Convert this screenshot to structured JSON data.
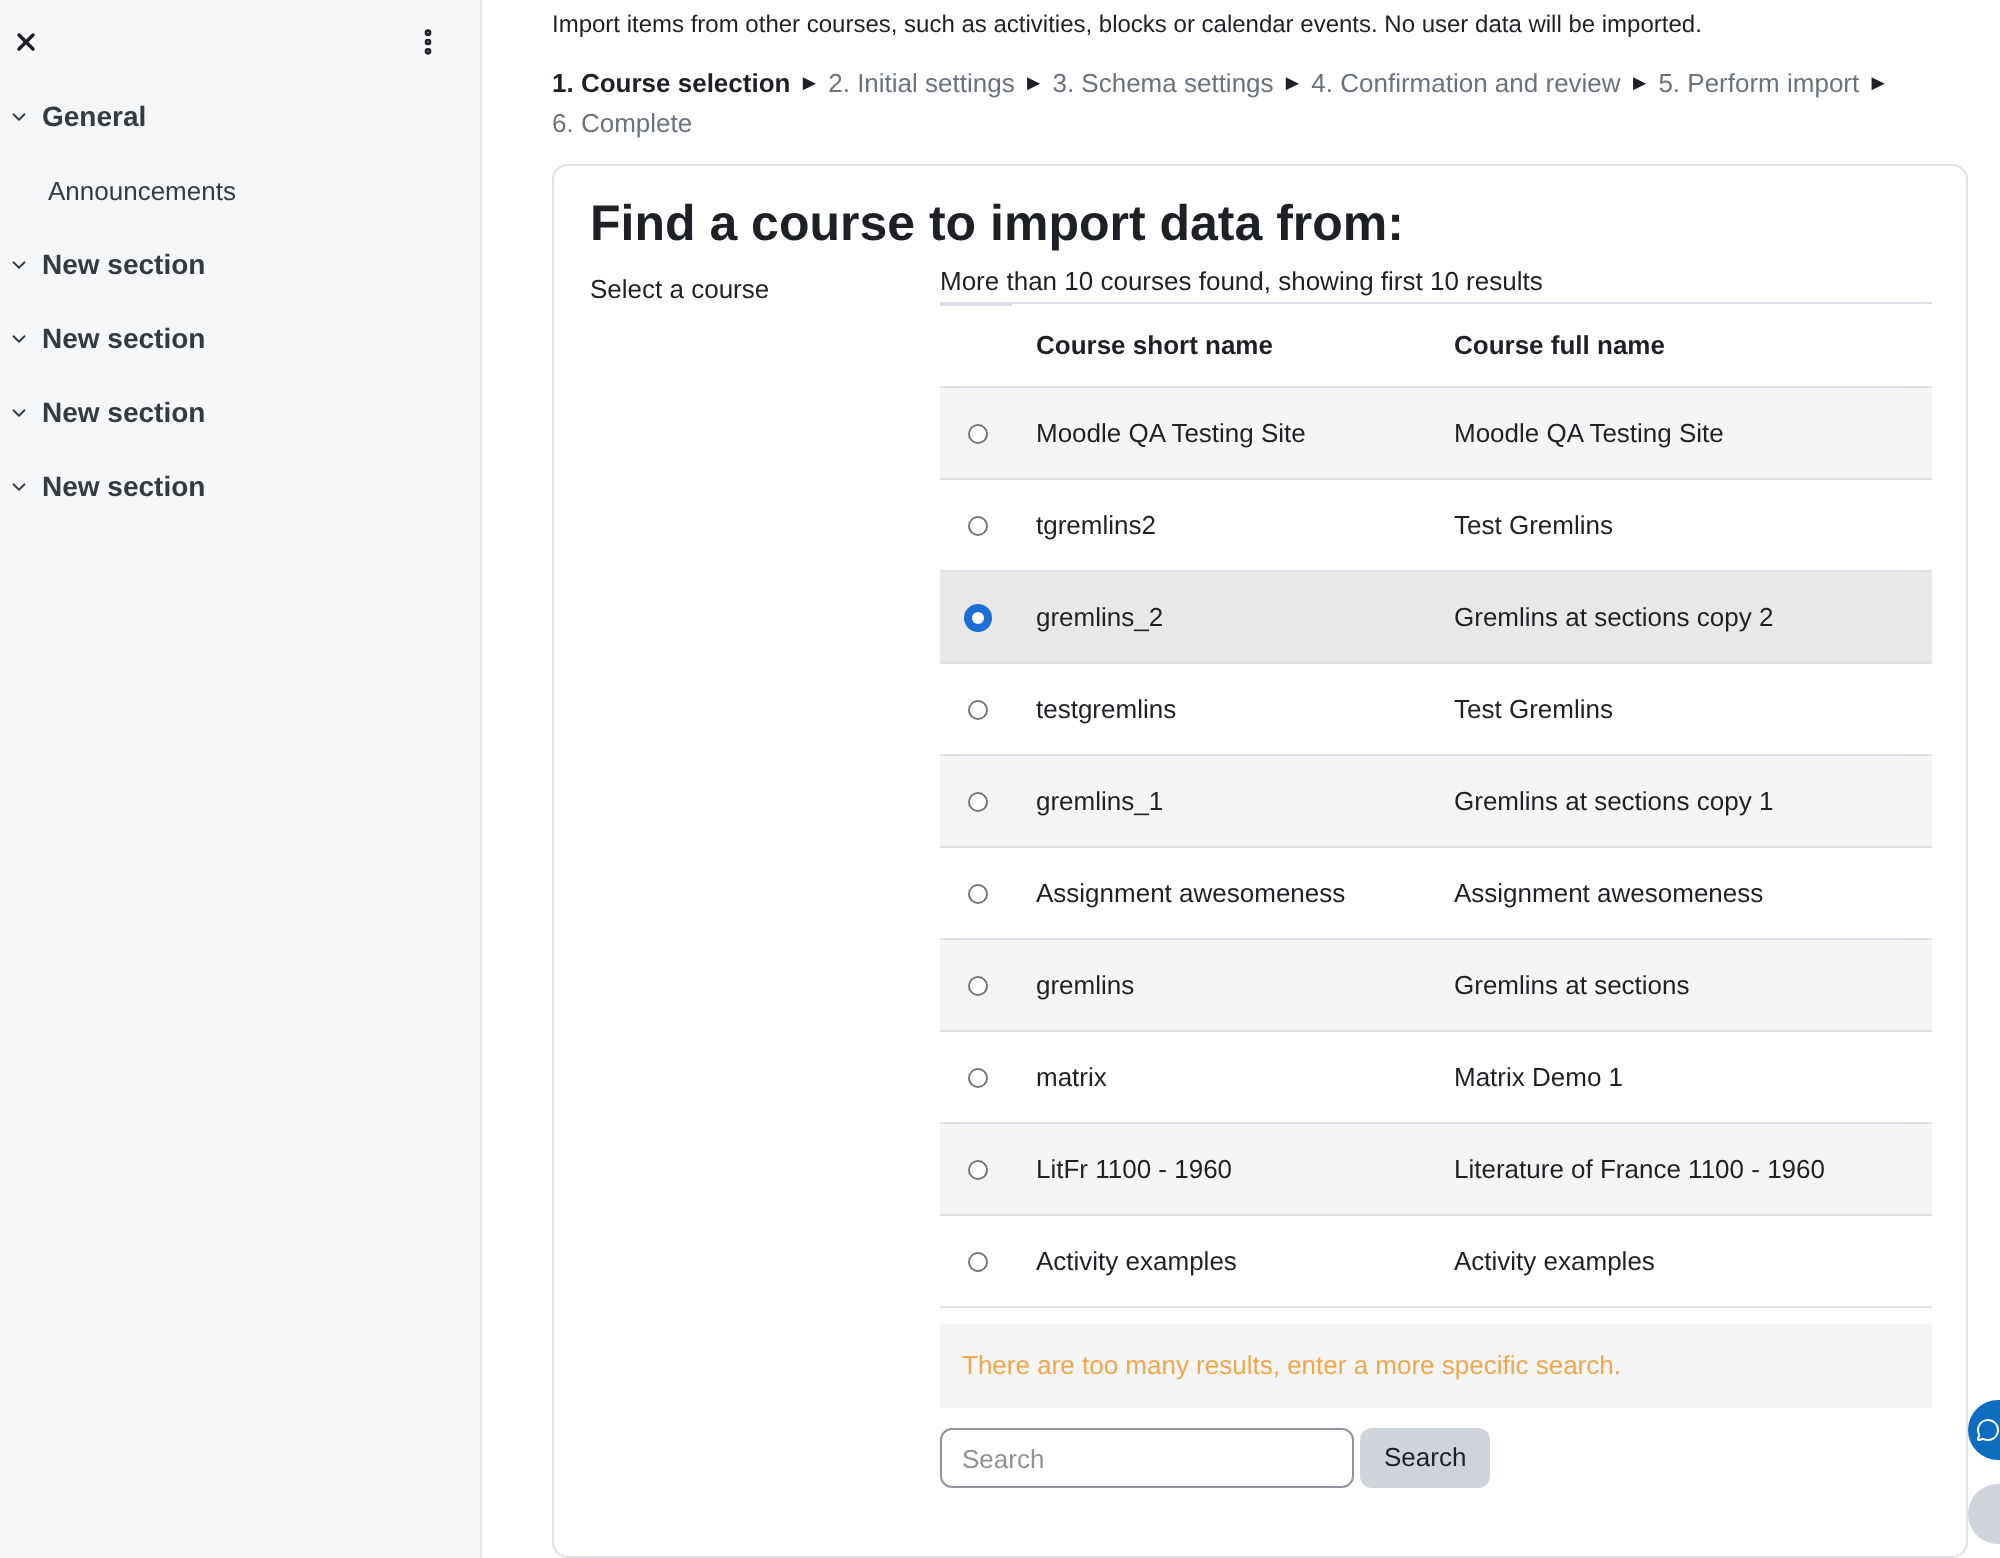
{
  "sidebar": {
    "sections": [
      {
        "title": "General",
        "expanded": true,
        "items": [
          "Announcements"
        ]
      },
      {
        "title": "New section",
        "expanded": true
      },
      {
        "title": "New section",
        "expanded": true
      },
      {
        "title": "New section",
        "expanded": true
      },
      {
        "title": "New section",
        "expanded": true
      }
    ]
  },
  "intro": "Import items from other courses, such as activities, blocks or calendar events. No user data will be imported.",
  "steps": [
    {
      "label": "1. Course selection",
      "selected": true
    },
    {
      "label": "2. Initial settings",
      "selected": false
    },
    {
      "label": "3. Schema settings",
      "selected": false
    },
    {
      "label": "4. Confirmation and review",
      "selected": false
    },
    {
      "label": "5. Perform import",
      "selected": false
    },
    {
      "label": "6. Complete",
      "selected": false
    }
  ],
  "step_separator": "►",
  "card": {
    "title": "Find a course to import data from:",
    "field_label": "Select a course",
    "result_note": "More than 10 courses found, showing first 10 results",
    "table": {
      "columns": [
        "Course short name",
        "Course full name"
      ],
      "rows": [
        {
          "short": "Moodle QA Testing Site",
          "full": "Moodle QA Testing Site",
          "selected": false
        },
        {
          "short": "tgremlins2",
          "full": "Test Gremlins",
          "selected": false
        },
        {
          "short": "gremlins_2",
          "full": "Gremlins at sections copy 2",
          "selected": true
        },
        {
          "short": "testgremlins",
          "full": "Test Gremlins",
          "selected": false
        },
        {
          "short": "gremlins_1",
          "full": "Gremlins at sections copy 1",
          "selected": false
        },
        {
          "short": "Assignment awesomeness",
          "full": "Assignment awesomeness",
          "selected": false
        },
        {
          "short": "gremlins",
          "full": "Gremlins at sections",
          "selected": false
        },
        {
          "short": "matrix",
          "full": "Matrix Demo 1",
          "selected": false
        },
        {
          "short": "LitFr 1100 - 1960",
          "full": "Literature of France 1100 - 1960",
          "selected": false
        },
        {
          "short": "Activity examples",
          "full": "Activity examples",
          "selected": false
        }
      ]
    },
    "warning": "There are too many results, enter a more specific search.",
    "search": {
      "placeholder": "Search",
      "button": "Search"
    }
  }
}
